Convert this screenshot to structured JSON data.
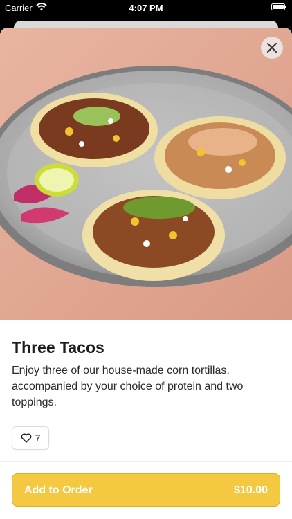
{
  "status_bar": {
    "carrier": "Carrier",
    "time": "4:07 PM"
  },
  "item": {
    "title": "Three Tacos",
    "description": "Enjoy three of our house-made corn tortillas, accompanied by your choice of protein and two toppings.",
    "likes": "7",
    "image": "tacos-photo"
  },
  "actions": {
    "add_label": "Add to Order",
    "price": "$10.00"
  },
  "colors": {
    "accent": "#f5c842",
    "accent_border": "#e0ae21",
    "background": "#ffffff"
  },
  "icons": [
    "wifi-icon",
    "battery-icon",
    "close-icon",
    "heart-icon"
  ]
}
